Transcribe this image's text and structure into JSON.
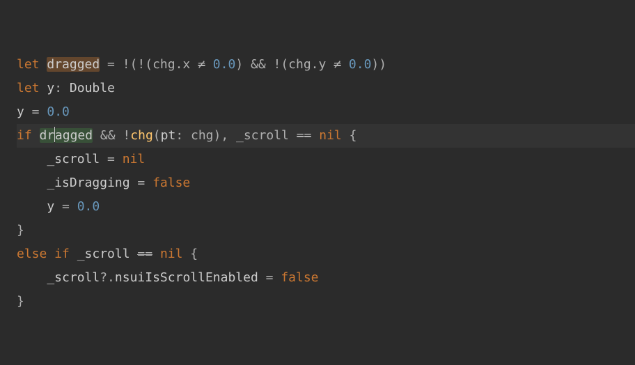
{
  "code": {
    "lines": [
      {
        "tokens": [
          {
            "cls": "kw",
            "t": "let "
          },
          {
            "cls": "id hl1",
            "t": "dragged"
          },
          {
            "cls": "pale",
            "t": " = !(!(chg.x "
          },
          {
            "cls": "pale strike",
            "t": "≠"
          },
          {
            "cls": "pale",
            "t": " "
          },
          {
            "cls": "num",
            "t": "0.0"
          },
          {
            "cls": "pale",
            "t": ") && !(chg.y "
          },
          {
            "cls": "pale strike",
            "t": "≠"
          },
          {
            "cls": "pale",
            "t": " "
          },
          {
            "cls": "num",
            "t": "0.0"
          },
          {
            "cls": "pale",
            "t": "))"
          }
        ]
      },
      {
        "tokens": [
          {
            "cls": "kw",
            "t": "let "
          },
          {
            "cls": "id",
            "t": "y"
          },
          {
            "cls": "pale",
            "t": ": "
          },
          {
            "cls": "type",
            "t": "Double"
          }
        ]
      },
      {
        "tokens": [
          {
            "cls": "id",
            "t": "y"
          },
          {
            "cls": "pale",
            "t": " = "
          },
          {
            "cls": "num",
            "t": "0.0"
          }
        ]
      },
      {
        "current": true,
        "tokens": [
          {
            "cls": "kw",
            "t": "if "
          },
          {
            "cls": "id hl2",
            "t": "dr"
          },
          {
            "caret": true
          },
          {
            "cls": "id hl2",
            "t": "agged"
          },
          {
            "cls": "pale",
            "t": " && !"
          },
          {
            "cls": "fn",
            "t": "chg"
          },
          {
            "cls": "pale",
            "t": "("
          },
          {
            "cls": "id",
            "t": "pt"
          },
          {
            "cls": "pale",
            "t": ": chg), _scroll "
          },
          {
            "cls": "pale strike",
            "t": "=="
          },
          {
            "cls": "pale",
            "t": " "
          },
          {
            "cls": "bool",
            "t": "nil"
          },
          {
            "cls": "pale",
            "t": " {"
          }
        ]
      },
      {
        "tokens": [
          {
            "cls": "id",
            "t": "    _scroll"
          },
          {
            "cls": "pale",
            "t": " = "
          },
          {
            "cls": "bool",
            "t": "nil"
          }
        ]
      },
      {
        "tokens": [
          {
            "cls": "id",
            "t": "    _isDragging"
          },
          {
            "cls": "pale",
            "t": " = "
          },
          {
            "cls": "bool",
            "t": "false"
          }
        ]
      },
      {
        "tokens": [
          {
            "cls": "id",
            "t": "    y"
          },
          {
            "cls": "pale",
            "t": " = "
          },
          {
            "cls": "num",
            "t": "0.0"
          }
        ]
      },
      {
        "tokens": [
          {
            "cls": "pale",
            "t": "}"
          }
        ]
      },
      {
        "tokens": [
          {
            "cls": "kw",
            "t": "else if "
          },
          {
            "cls": "id",
            "t": "_scroll"
          },
          {
            "cls": "pale",
            "t": " "
          },
          {
            "cls": "pale strike",
            "t": "=="
          },
          {
            "cls": "pale",
            "t": " "
          },
          {
            "cls": "bool",
            "t": "nil"
          },
          {
            "cls": "pale",
            "t": " {"
          }
        ]
      },
      {
        "tokens": [
          {
            "cls": "id",
            "t": "    _scroll"
          },
          {
            "cls": "pale",
            "t": "?."
          },
          {
            "cls": "id",
            "t": "nsuiIsScrollEnabled"
          },
          {
            "cls": "pale",
            "t": " = "
          },
          {
            "cls": "bool",
            "t": "false"
          }
        ]
      },
      {
        "tokens": [
          {
            "cls": "pale",
            "t": "}"
          }
        ]
      }
    ]
  }
}
